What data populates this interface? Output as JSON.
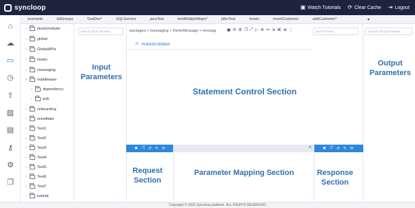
{
  "header": {
    "logo_text": "syncloop",
    "watch_label": "Watch Tutorials",
    "clear_label": "Clear Cache",
    "logout_label": "Logout"
  },
  "tabs": [
    "everwrite",
    "tstGroups",
    "TestDev*",
    "SQLService",
    "javaTest",
    "testMultipleMaps*",
    "jdbcTest",
    "howto",
    "insertCustomer",
    "addCustomer*"
  ],
  "tabs_more": "▾",
  "tree": {
    "items": [
      "ekaScheduler",
      "global",
      "GlobalAPIs",
      "howto",
      "messaging",
      "middleware",
      "dependency",
      "pub",
      "onboarding",
      "snowflake",
      "Test1",
      "Test2",
      "Test3",
      "Test4",
      "Test5",
      "Test6",
      "Test7",
      "tutorial"
    ]
  },
  "inputs": {
    "search_placeholder": "Search Input Parame..."
  },
  "center": {
    "breadcrumb": "packages > messaging > DemoMessage > messag",
    "search_placeholder": "Search Flow...",
    "transformer_label": "TRANSFORMER"
  },
  "outputs": {
    "search_placeholder": "Search Output Parame..."
  },
  "labels": {
    "input_parameters": "Input Parameters",
    "output_parameters": "Output Parameters",
    "statement_control": "Statement Control Section",
    "request_section": "Request Section",
    "parameter_mapping": "Parameter Mapping Section",
    "response_section": "Response Section"
  },
  "footer": {
    "copyright": "Copyright © 2023 Syncloop platform. ALL RIGHTS RESERVED."
  },
  "colors": {
    "topbar": "#1e2340",
    "accent": "#2e86de",
    "overlay_text": "#2f6fb0"
  }
}
